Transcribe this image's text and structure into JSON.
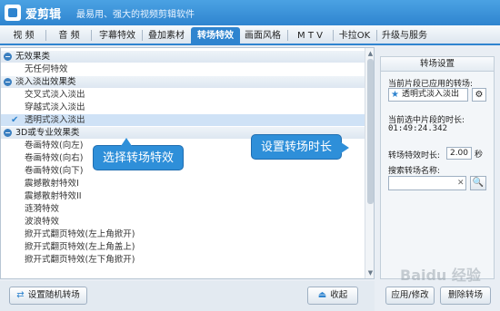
{
  "app": {
    "title": "爱剪辑",
    "subtitle": "最易用、强大的视频剪辑软件"
  },
  "tabs": [
    {
      "label": "视 频"
    },
    {
      "label": "音 频"
    },
    {
      "label": "字幕特效"
    },
    {
      "label": "叠加素材"
    },
    {
      "label": "转场特效",
      "active": true
    },
    {
      "label": "画面风格"
    },
    {
      "label": "M T V"
    },
    {
      "label": "卡拉OK"
    },
    {
      "label": "升级与服务"
    }
  ],
  "list": {
    "groups": [
      {
        "label": "无效果类",
        "items": [
          "无任何特效"
        ]
      },
      {
        "label": "淡入淡出效果类",
        "items": [
          "交叉式淡入淡出",
          "穿越式淡入淡出",
          "透明式淡入淡出"
        ],
        "selected": "透明式淡入淡出"
      },
      {
        "label": "3D或专业效果类",
        "items": [
          "卷画特效(向左)",
          "卷画特效(向右)",
          "卷画特效(向下)",
          "震撼散射特效I",
          "震撼散射特效II",
          "涟漪特效",
          "波浪特效",
          "掀开式翻页特效(左上角掀开)",
          "掀开式翻页特效(左上角盖上)",
          "掀开式翻页特效(左下角掀开)"
        ]
      }
    ],
    "toggle_symbol": "−"
  },
  "callouts": {
    "select_effect": "选择转场特效",
    "set_duration": "设置转场时长"
  },
  "bottom": {
    "random_button": "设置随机转场",
    "collapse_button": "收起"
  },
  "settings": {
    "header": "转场设置",
    "applied_label": "当前片段已应用的转场:",
    "applied_value": "透明式淡入淡出",
    "current_duration_label": "当前选中片段的时长:",
    "current_duration_value": "01:49:24.342",
    "effect_duration_label": "转场特效时长:",
    "effect_duration_value": "2.00",
    "effect_duration_unit": "秒",
    "search_label": "搜索转场名称:",
    "search_value": "",
    "apply_button": "应用/修改",
    "delete_button": "删除转场"
  },
  "watermark": "Baidu 经验"
}
